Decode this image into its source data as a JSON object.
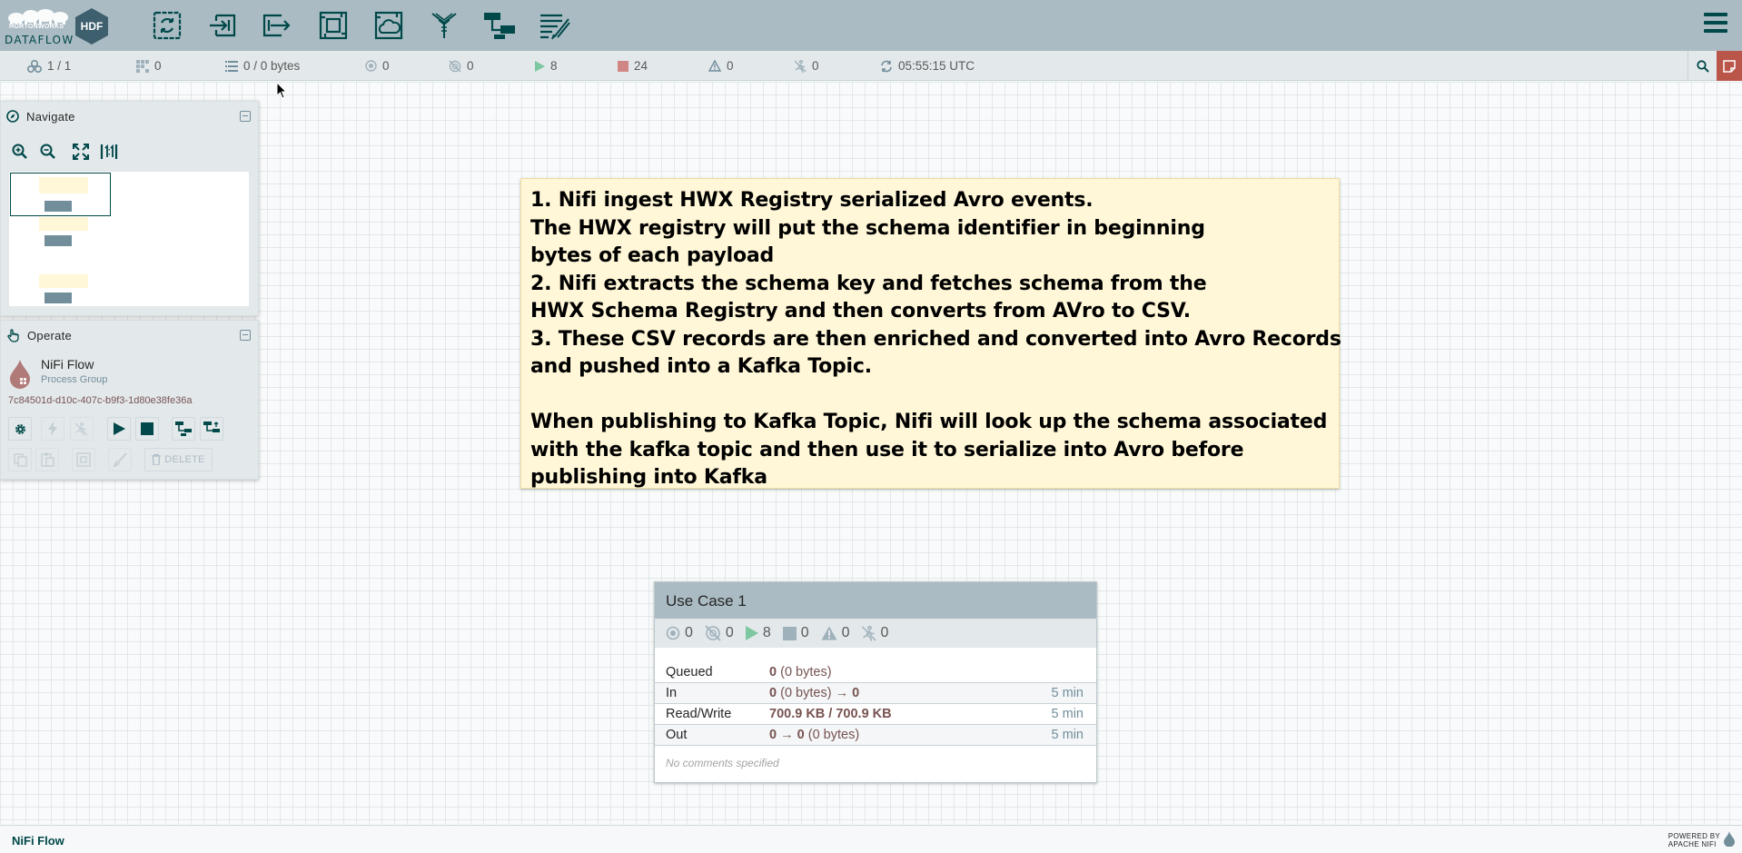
{
  "header": {
    "brand_small": "HORTONWORKS",
    "brand_badge": "HDF",
    "brand_name": "DATAFLOW",
    "toolbar": [
      {
        "icon": "processor-icon"
      },
      {
        "icon": "input-port-icon"
      },
      {
        "icon": "output-port-icon"
      },
      {
        "icon": "process-group-icon"
      },
      {
        "icon": "remote-process-group-icon"
      },
      {
        "icon": "funnel-icon"
      },
      {
        "icon": "template-icon"
      },
      {
        "icon": "label-icon"
      }
    ],
    "colors": {
      "bar": "#aabbc3",
      "icon": "#004849"
    }
  },
  "status": {
    "clusters": "1 / 1",
    "threads": "0",
    "queued": "0 / 0 bytes",
    "transmitting": "0",
    "not_transmitting": "0",
    "running": "8",
    "stopped": "24",
    "invalid": "0",
    "disabled": "0",
    "refresh_time": "05:55:15 UTC",
    "colors": {
      "running": "#7dc7a0",
      "stopped": "#d18686"
    }
  },
  "navigate": {
    "title": "Navigate"
  },
  "operate": {
    "title": "Operate",
    "name": "NiFi Flow",
    "type": "Process Group",
    "id": "7c84501d-d10c-407c-b9f3-1d80e38fe36a",
    "delete_label": "DELETE"
  },
  "label": {
    "text": "1. Nifi ingest HWX Registry serialized Avro events.\nThe HWX registry will put the schema identifier in beginning\nbytes of each payload\n2. Nifi extracts the schema key and fetches schema from the\nHWX Schema Registry and then converts from AVro to CSV.\n3. These CSV records are then enriched and converted into Avro Records\nand pushed into a Kafka Topic.\n\nWhen publishing to Kafka Topic, Nifi will look up the schema associated\nwith the kafka topic and then use it to serialize into Avro before\npublishing into Kafka"
  },
  "process_group": {
    "name": "Use Case 1",
    "stats": {
      "transmitting": "0",
      "not_transmitting": "0",
      "running": "8",
      "stopped": "0",
      "invalid": "0",
      "disabled": "0"
    },
    "rows": {
      "queued_label": "Queued",
      "queued_value": "0",
      "queued_bytes": "(0 bytes)",
      "in_label": "In",
      "in_value": "0",
      "in_bytes": "(0 bytes)",
      "in_arrow": "→",
      "in_out": "0",
      "in_time": "5 min",
      "rw_label": "Read/Write",
      "rw_value": "700.9 KB / 700.9 KB",
      "rw_time": "5 min",
      "out_label": "Out",
      "out_value": "0",
      "out_arrow": "→",
      "out_out": "0",
      "out_bytes": "(0 bytes)",
      "out_time": "5 min"
    },
    "comments": "No comments specified"
  },
  "footer": {
    "breadcrumb": "NiFi Flow",
    "powered_by": "POWERED BY",
    "apache_nifi": "APACHE NIFI"
  }
}
